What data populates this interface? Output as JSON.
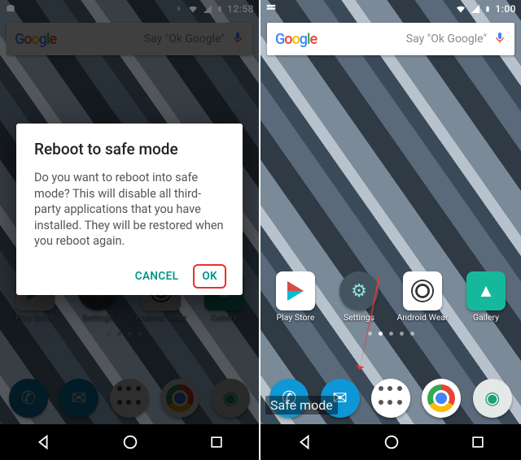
{
  "left": {
    "statusbar": {
      "clock": "12:58"
    },
    "search": {
      "logo": "Google",
      "hint": "Say \"Ok Google\""
    },
    "apps_row": [
      {
        "name": "play-store",
        "label": "Play Store"
      },
      {
        "name": "settings",
        "label": "Settings"
      },
      {
        "name": "android-wear",
        "label": "Android Wear"
      },
      {
        "name": "gallery",
        "label": "Gallery"
      }
    ],
    "dialog": {
      "title": "Reboot to safe mode",
      "body": "Do you want to reboot into safe mode? This will disable all third-party applications that you have installed. They will be restored when you reboot again.",
      "cancel": "Cancel",
      "ok": "OK"
    }
  },
  "right": {
    "statusbar": {
      "clock": "1:00"
    },
    "search": {
      "logo": "Google",
      "hint": "Say \"Ok Google\""
    },
    "apps_row": [
      {
        "name": "play-store",
        "label": "Play Store"
      },
      {
        "name": "settings",
        "label": "Settings"
      },
      {
        "name": "android-wear",
        "label": "Android Wear"
      },
      {
        "name": "gallery",
        "label": "Gallery"
      }
    ],
    "safe_mode_badge": "Safe mode"
  }
}
